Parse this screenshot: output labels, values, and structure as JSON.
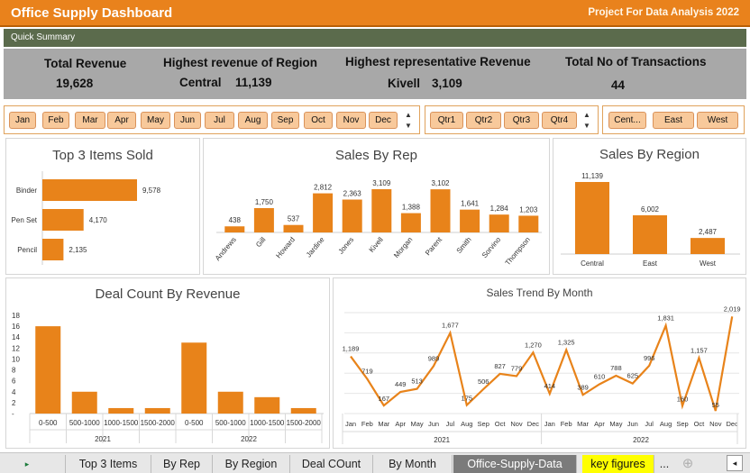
{
  "header": {
    "title": "Office Supply Dashboard",
    "project": "Project For Data Analysis 2022"
  },
  "quick_summary": {
    "label": "Quick Summary"
  },
  "kpis": {
    "total_revenue": {
      "label": "Total Revenue",
      "value": "19,628"
    },
    "highest_region": {
      "label": "Highest revenue of Region",
      "name": "Central",
      "value": "11,139"
    },
    "highest_rep": {
      "label": "Highest representative Revenue",
      "name": "Kivell",
      "value": "3,109"
    },
    "transactions": {
      "label": "Total No of Transactions",
      "value": "44"
    }
  },
  "slicers": {
    "months": [
      "Jan",
      "Feb",
      "Mar",
      "Apr",
      "May",
      "Jun",
      "Jul",
      "Aug",
      "Sep",
      "Oct",
      "Nov",
      "Dec"
    ],
    "quarters": [
      "Qtr1",
      "Qtr2",
      "Qtr3",
      "Qtr4"
    ],
    "regions": [
      "Cent...",
      "East",
      "West"
    ],
    "scroll_up": "▲",
    "scroll_down": "▼"
  },
  "chart_data": [
    {
      "type": "bar",
      "title": "Top 3 Items Sold",
      "orientation": "horizontal",
      "categories": [
        "Binder",
        "Pen Set",
        "Pencil"
      ],
      "values": [
        9578,
        4170,
        2135
      ],
      "labels": [
        "9,578",
        "4,170",
        "2,135"
      ],
      "color": "#e8831a"
    },
    {
      "type": "bar",
      "title": "Sales By Rep",
      "categories": [
        "Andrews",
        "Gill",
        "Howard",
        "Jardine",
        "Jones",
        "Kivell",
        "Morgan",
        "Parent",
        "Smith",
        "Sorvino",
        "Thompson"
      ],
      "values": [
        438,
        1750,
        537,
        2812,
        2363,
        3109,
        1388,
        3102,
        1641,
        1284,
        1203
      ],
      "labels": [
        "438",
        "1,750",
        "537",
        "2,812",
        "2,363",
        "3,109",
        "1,388",
        "3,102",
        "1,641",
        "1,284",
        "1,203"
      ],
      "color": "#e8831a"
    },
    {
      "type": "bar",
      "title": "Sales By Region",
      "categories": [
        "Central",
        "East",
        "West"
      ],
      "values": [
        11139,
        6002,
        2487
      ],
      "labels": [
        "11,139",
        "6,002",
        "2,487"
      ],
      "color": "#e8831a"
    },
    {
      "type": "bar",
      "title": "Deal Count By Revenue",
      "categories": [
        "0-500",
        "500-1000",
        "1000-1500",
        "1500-2000",
        "0-500",
        "500-1000",
        "1000-1500",
        "1500-2000"
      ],
      "groups": [
        "2021",
        "2022"
      ],
      "values": [
        16,
        4,
        1,
        1,
        13,
        4,
        3,
        1
      ],
      "ylim": [
        0,
        18
      ],
      "yticks": [
        "18",
        "16",
        "14",
        "12",
        "10",
        "8",
        "6",
        "4",
        "2",
        "-"
      ],
      "color": "#e8831a"
    },
    {
      "type": "line",
      "title": "Sales Trend By Month",
      "categories": [
        "Jan",
        "Feb",
        "Mar",
        "Apr",
        "May",
        "Jun",
        "Jul",
        "Aug",
        "Sep",
        "Oct",
        "Nov",
        "Dec",
        "Jan",
        "Feb",
        "Mar",
        "Apr",
        "May",
        "Jun",
        "Jul",
        "Aug",
        "Sep",
        "Oct",
        "Nov",
        "Dec"
      ],
      "groups": [
        "2021",
        "2022"
      ],
      "values": [
        1189,
        719,
        167,
        449,
        513,
        989,
        1677,
        175,
        506,
        827,
        779,
        1270,
        414,
        1325,
        389,
        610,
        788,
        625,
        996,
        1831,
        160,
        1157,
        55,
        2019
      ],
      "labels": [
        "1,189",
        "719",
        "167",
        "449",
        "513",
        "989",
        "1,677",
        "175",
        "506",
        "827",
        "779",
        "1,270",
        "414",
        "1,325",
        "389",
        "610",
        "788",
        "625",
        "996",
        "1,831",
        "160",
        "1,157",
        "55",
        "2,019"
      ],
      "ylim": [
        0,
        2100
      ],
      "color": "#e8831a"
    }
  ],
  "tabs": {
    "items": [
      "Top 3 Items",
      "By Rep",
      "By Region",
      "Deal COunt",
      "By Month",
      "Office-Supply-Data",
      "key figures"
    ],
    "active": "Office-Supply-Data",
    "highlight": "key figures",
    "more": "...",
    "add": "⊕",
    "nav_right": "▸",
    "nav_left": "◂"
  }
}
